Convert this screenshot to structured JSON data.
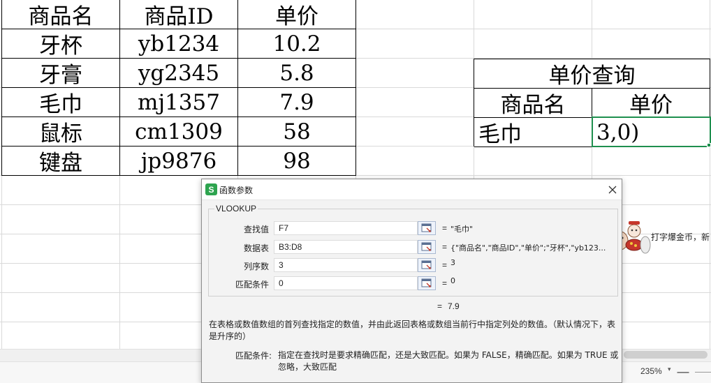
{
  "sheet": {
    "product_table": {
      "headers": [
        "商品名",
        "商品ID",
        "单价"
      ],
      "rows": [
        [
          "牙杯",
          "yb1234",
          "10.2"
        ],
        [
          "牙膏",
          "yg2345",
          "5.8"
        ],
        [
          "毛巾",
          "mj1357",
          "7.9"
        ],
        [
          "鼠标",
          "cm1309",
          "58"
        ],
        [
          "键盘",
          "jp9876",
          "98"
        ]
      ]
    },
    "lookup_table": {
      "title": "单价查询",
      "header_name": "商品名",
      "header_price": "单价",
      "value_name": "毛巾",
      "value_price": "3,0)"
    }
  },
  "promo": {
    "text": "打字爆金币，新"
  },
  "status_bar": {
    "zoom": "235%",
    "zoom_caret": "▾",
    "zoom_minus": "—"
  },
  "dialog": {
    "title": "函数参数",
    "app_icon_letter": "S",
    "function_name": "VLOOKUP",
    "args": [
      {
        "label": "查找值",
        "value": "F7",
        "eq": "=",
        "result": "\"毛巾\""
      },
      {
        "label": "数据表",
        "value": "B3:D8",
        "eq": "=",
        "result": "{\"商品名\",\"商品ID\",\"单价\";\"牙杯\",\"yb123..."
      },
      {
        "label": "列序数",
        "value": "3",
        "eq": "=",
        "result": "3"
      },
      {
        "label": "匹配条件",
        "value": "0",
        "eq": "=",
        "result": "0"
      }
    ],
    "result_eq": "=",
    "result_value": "7.9",
    "description": "在表格或数值数组的首列查找指定的数值，并由此返回表格或数组当前行中指定列处的数值。（默认情况下，表是升序的）",
    "param_help_label": "匹配条件:",
    "param_help_text": "指定在查找时是要求精确匹配，还是大致匹配。如果为 FALSE，精确匹配。如果为 TRUE 或忽略，大致匹配"
  },
  "colors": {
    "selection": "#1e8f4e",
    "app_icon": "#2ea44f",
    "grid": "#d9d9d9"
  },
  "icons": {
    "close": "close-icon",
    "ref": "range-select-icon",
    "mascot": "mascot-icon"
  }
}
